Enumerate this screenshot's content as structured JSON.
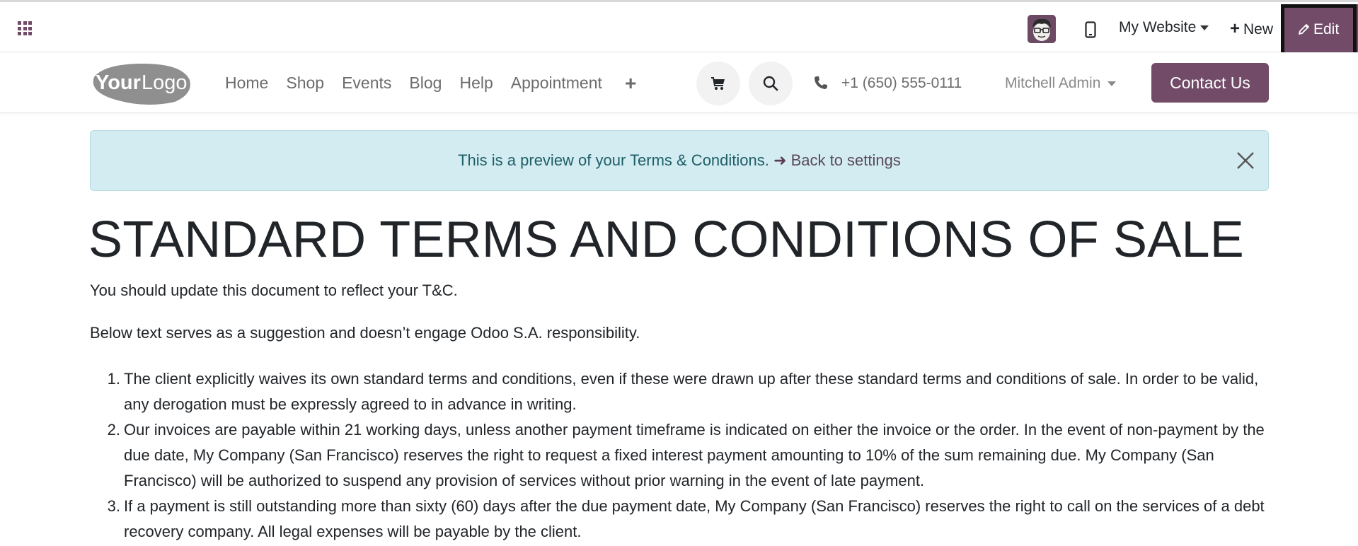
{
  "admin_bar": {
    "apps_icon": "apps-grid-icon",
    "avatar_alt": "user-avatar",
    "mobile_preview_icon": "mobile-phone-icon",
    "website_switcher": "My Website",
    "new_label": "New",
    "edit_label": "Edit",
    "accent_color": "#714b67"
  },
  "header": {
    "logo_text_bold": "Your",
    "logo_text_light": "Logo",
    "nav": [
      {
        "label": "Home"
      },
      {
        "label": "Shop"
      },
      {
        "label": "Events"
      },
      {
        "label": "Blog"
      },
      {
        "label": "Help"
      },
      {
        "label": "Appointment"
      }
    ],
    "nav_add_icon": "+",
    "cart_icon": "shopping-cart-icon",
    "search_icon": "search-icon",
    "phone": "+1 (650) 555-0111",
    "user_name": "Mitchell Admin",
    "contact_button": "Contact Us"
  },
  "alert": {
    "message": "This is a preview of your Terms & Conditions.",
    "arrow": "➜",
    "link_label": "Back to settings",
    "background_color": "#d2ecf1"
  },
  "content": {
    "title": "STANDARD TERMS AND CONDITIONS OF SALE",
    "intro_1": "You should update this document to reflect your T&C.",
    "intro_2": "Below text serves as a suggestion and doesn’t engage Odoo S.A. responsibility.",
    "terms": [
      {
        "num": "1.",
        "text": "The client explicitly waives its own standard terms and conditions, even if these were drawn up after these standard terms and conditions of sale. In order to be valid, any derogation must be expressly agreed to in advance in writing."
      },
      {
        "num": "2.",
        "text": "Our invoices are payable within 21 working days, unless another payment timeframe is indicated on either the invoice or the order. In the event of non-payment by the due date, My Company (San Francisco) reserves the right to request a fixed interest payment amounting to 10% of the sum remaining due. My Company (San Francisco) will be authorized to suspend any provision of services without prior warning in the event of late payment."
      },
      {
        "num": "3.",
        "text": "If a payment is still outstanding more than sixty (60) days after the due payment date, My Company (San Francisco) reserves the right to call on the services of a debt recovery company. All legal expenses will be payable by the client."
      }
    ]
  }
}
